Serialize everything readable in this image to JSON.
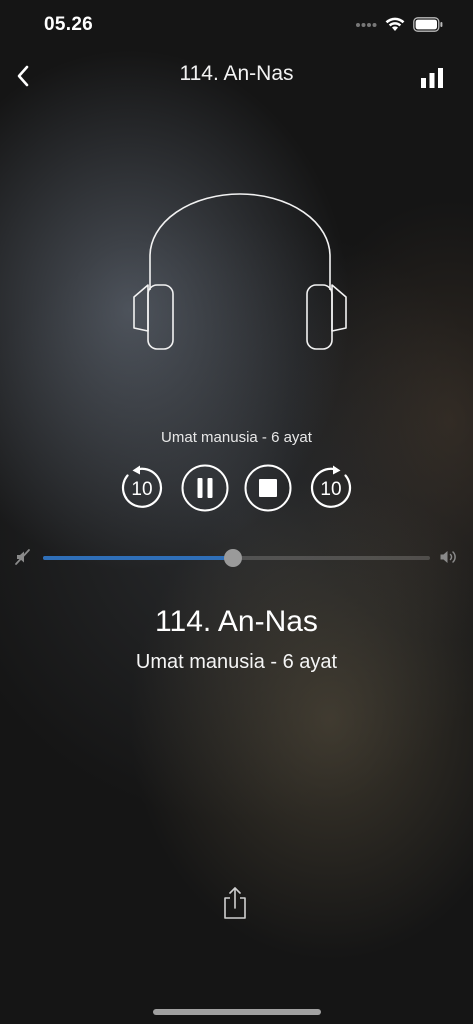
{
  "status_bar": {
    "time": "05.26",
    "icons": [
      "signal-dots-icon",
      "wifi-icon",
      "battery-icon"
    ]
  },
  "nav": {
    "back_icon": "chevron-left-icon",
    "title": "114. An-Nas",
    "right_icon": "bar-chart-icon"
  },
  "player": {
    "artwork_icon": "headphones-icon",
    "subtitle_small": "Umat manusia - 6 ayat",
    "controls": {
      "rewind_label": "10",
      "forward_label": "10",
      "rewind_icon": "rewind-10-icon",
      "pause_icon": "pause-icon",
      "stop_icon": "stop-icon",
      "forward_icon": "forward-10-icon"
    },
    "volume": {
      "level_fraction": 0.49,
      "min_icon": "volume-mute-icon",
      "max_icon": "volume-max-icon"
    },
    "title": "114. An-Nas",
    "subtitle": "Umat manusia - 6 ayat",
    "share_icon": "share-icon"
  },
  "colors": {
    "accent": "#2f6fb8",
    "thumb": "#9a9a9a",
    "background": "#151515"
  }
}
